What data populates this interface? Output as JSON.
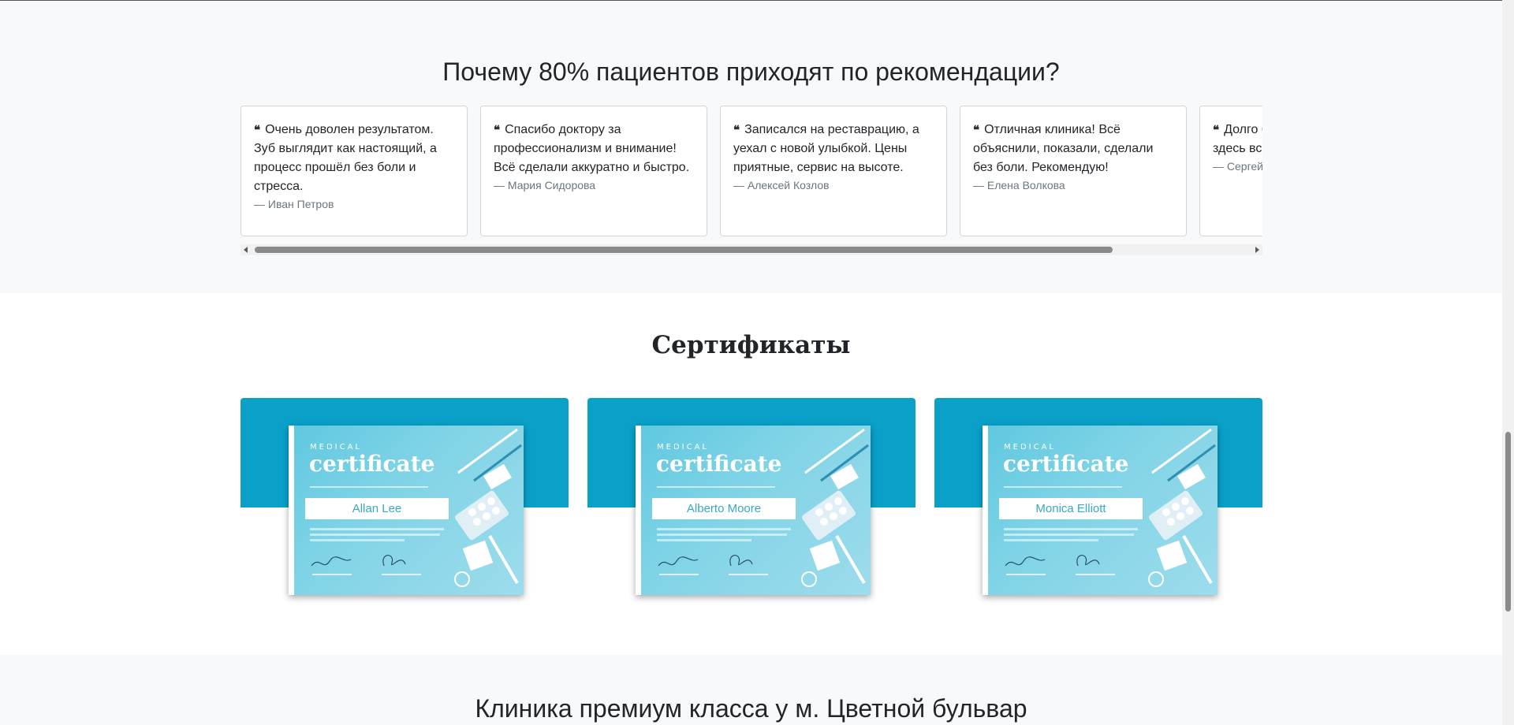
{
  "reviews": {
    "title": "Почему 80% пациентов приходят по рекомендации?",
    "quote_glyph": "❝",
    "items": [
      {
        "text": "Очень доволен результатом. Зуб выглядит как настоящий, а процесс прошёл без боли и стресса.",
        "author": "— Иван Петров"
      },
      {
        "text": "Спасибо доктору за профессионализм и внимание! Всё сделали аккуратно и быстро.",
        "author": "— Мария Сидорова"
      },
      {
        "text": "Записался на реставрацию, а уехал с новой улыбкой. Цены приятные, сервис на высоте.",
        "author": "— Алексей Козлов"
      },
      {
        "text": "Отличная клиника! Всё объяснили, показали, сделали без боли. Рекомендую!",
        "author": "— Елена Волкова"
      },
      {
        "text": "Долго боялся стоматологов, но здесь всё прошло легко. Очень",
        "author": "— Сергей"
      }
    ]
  },
  "certificates": {
    "title": "Сертификаты",
    "items": [
      {
        "top_word": "MEDICAL",
        "main_word": "certificate",
        "name": "Allan Lee"
      },
      {
        "top_word": "MEDICAL",
        "main_word": "certificate",
        "name": "Alberto Moore"
      },
      {
        "top_word": "MEDICAL",
        "main_word": "certificate",
        "name": "Monica Elliott"
      }
    ],
    "band_color": "#0aa0c8"
  },
  "bottom": {
    "title": "Клиника премиум класса у м. Цветной бульвар"
  }
}
